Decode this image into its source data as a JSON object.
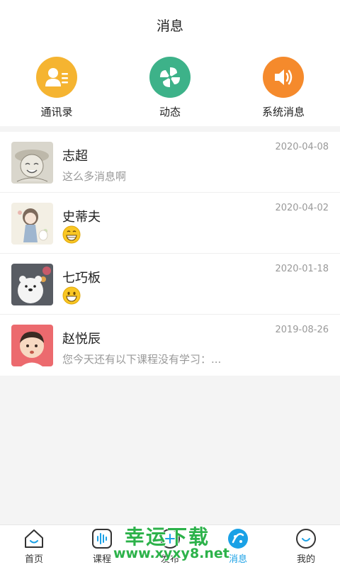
{
  "header": {
    "title": "消息"
  },
  "quick_actions": [
    {
      "label": "通讯录",
      "icon": "contacts-icon",
      "color": "#f5b431"
    },
    {
      "label": "动态",
      "icon": "pinwheel-icon",
      "color": "#3db289"
    },
    {
      "label": "系统消息",
      "icon": "speaker-icon",
      "color": "#f58a2c"
    }
  ],
  "messages": [
    {
      "name": "志超",
      "date": "2020-04-08",
      "preview": "这么多消息啊",
      "avatar": "sketch-boy-avatar"
    },
    {
      "name": "史蒂夫",
      "date": "2020-04-02",
      "preview": "",
      "emoji": "grin-emoji",
      "avatar": "girl-illustration-avatar"
    },
    {
      "name": "七巧板",
      "date": "2020-01-18",
      "preview": "",
      "emoji": "smile-emoji",
      "avatar": "polar-bear-avatar"
    },
    {
      "name": "赵悦辰",
      "date": "2019-08-26",
      "preview": "您今天还有以下课程没有学习：...",
      "avatar": "cartoon-boy-avatar"
    }
  ],
  "tabbar": {
    "items": [
      {
        "label": "首页",
        "icon": "home-icon"
      },
      {
        "label": "课程",
        "icon": "course-icon"
      },
      {
        "label": "发布",
        "icon": "publish-icon"
      },
      {
        "label": "消息",
        "icon": "message-icon",
        "active": true
      },
      {
        "label": "我的",
        "icon": "profile-icon"
      }
    ]
  },
  "watermark": {
    "line1": "幸运下载",
    "line2": "www.xyxy8.net"
  },
  "colors": {
    "accent": "#1aa1e6",
    "watermark": "#2cb24a"
  }
}
